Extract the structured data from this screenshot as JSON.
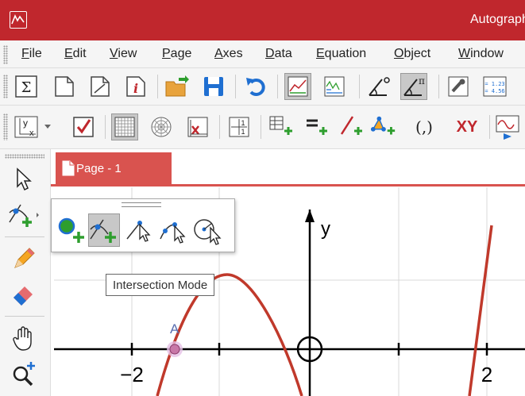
{
  "window": {
    "title": "Autograph"
  },
  "menu": {
    "items": [
      {
        "key": "F",
        "rest": "ile"
      },
      {
        "key": "E",
        "rest": "dit"
      },
      {
        "key": "V",
        "rest": "iew"
      },
      {
        "key": "P",
        "rest": "age"
      },
      {
        "key": "A",
        "rest": "xes"
      },
      {
        "key": "D",
        "rest": "ata"
      },
      {
        "key": "E",
        "rest": "quation"
      },
      {
        "key": "O",
        "rest": "bject"
      },
      {
        "key": "W",
        "rest": "indow"
      }
    ]
  },
  "toolbar2": {
    "xy_label": "XY",
    "coord_label": "(,)",
    "one_one": "1",
    "y_label": "y",
    "x_label": "x"
  },
  "document": {
    "tab_label": "Page - 1"
  },
  "graph": {
    "y_axis_label": "y",
    "tick_neg2": "−2",
    "tick_2": "2",
    "point_label": "A"
  },
  "tooltip": {
    "text": "Intersection Mode"
  },
  "colors": {
    "titlebar": "#c0272d",
    "curve": "#c0392b",
    "tab": "#d9534f",
    "accent_green": "#2e9e2e",
    "accent_blue": "#1f6fd1"
  },
  "icons": [
    "app-logo-icon",
    "sum-icon",
    "new-page-icon",
    "new-2d-page-icon",
    "info-icon",
    "open-folder-icon",
    "save-icon",
    "undo-icon",
    "graph-settings-icon",
    "data-icon",
    "angle-degree-icon",
    "angle-pi-icon",
    "properties-icon",
    "number-format-icon",
    "axes-label-icon",
    "checkbox-icon",
    "grid-square-icon",
    "polar-grid-icon",
    "x-mark-icon",
    "scale-icon",
    "add-table-icon",
    "add-equation-icon",
    "add-line-icon",
    "add-shape-icon",
    "coordinates-icon",
    "xy-icon",
    "animate-icon",
    "select-arrow-icon",
    "point-mode-icon",
    "pencil-icon",
    "eraser-icon",
    "hand-icon",
    "zoom-icon"
  ]
}
